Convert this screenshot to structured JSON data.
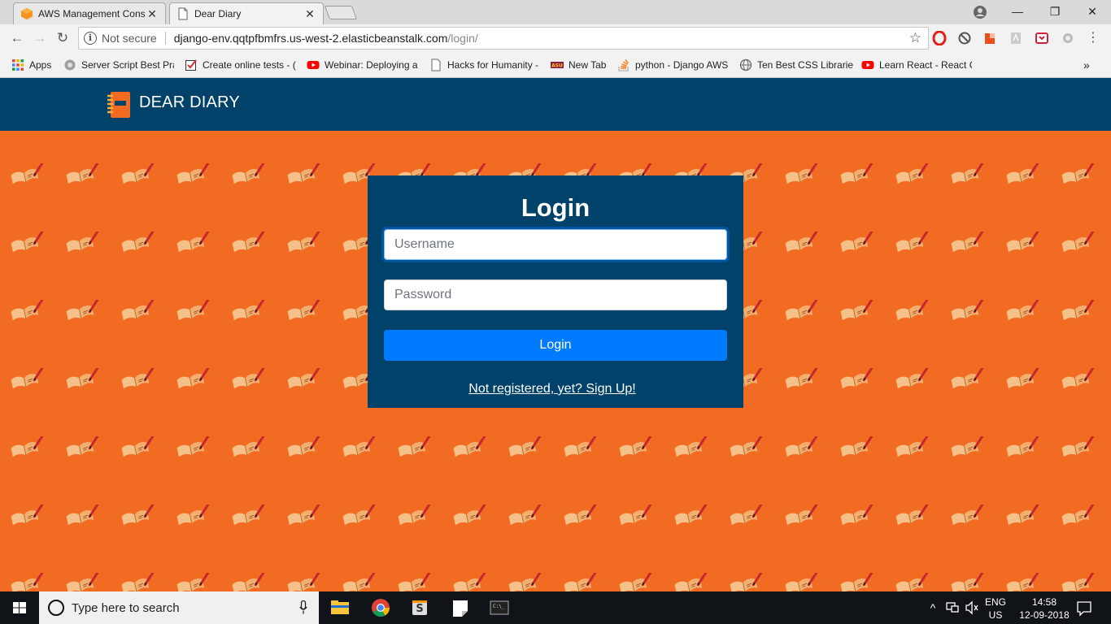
{
  "browser": {
    "tabs": [
      {
        "title": "AWS Management Conso",
        "active": false,
        "icon": "aws-cube-icon"
      },
      {
        "title": "Dear Diary",
        "active": true,
        "icon": "page-icon"
      }
    ],
    "window_controls": {
      "minimize": "—",
      "maximize": "❐",
      "close": "✕"
    },
    "address": {
      "security_label": "Not secure",
      "host": "django-env.qqtpfbmfrs.us-west-2.elasticbeanstalk.com",
      "path": "/login/"
    },
    "bookmarks": [
      {
        "label": "Apps",
        "icon": "apps-grid-icon"
      },
      {
        "label": "Server Script Best Pra",
        "icon": "globe-icon"
      },
      {
        "label": "Create online tests - (",
        "icon": "checkbox-icon"
      },
      {
        "label": "Webinar: Deploying a",
        "icon": "youtube-icon"
      },
      {
        "label": "Hacks for Humanity -",
        "icon": "page-icon"
      },
      {
        "label": "New Tab",
        "icon": "asu-icon"
      },
      {
        "label": "python - Django AWS",
        "icon": "stackoverflow-icon"
      },
      {
        "label": "Ten Best CSS Libraries",
        "icon": "globe-icon"
      },
      {
        "label": "Learn React - React C",
        "icon": "youtube-icon"
      }
    ],
    "overflow_label": "»"
  },
  "site": {
    "brand": "DEAR DIARY",
    "login": {
      "title": "Login",
      "username_placeholder": "Username",
      "password_placeholder": "Password",
      "submit_label": "Login",
      "signup_link": "Not registered, yet? Sign Up!"
    },
    "colors": {
      "header": "#00426a",
      "background": "#f26b23",
      "button": "#007bff"
    }
  },
  "taskbar": {
    "search_placeholder": "Type here to search",
    "language": "ENG",
    "region": "US",
    "time": "14:58",
    "date": "12-09-2018"
  }
}
